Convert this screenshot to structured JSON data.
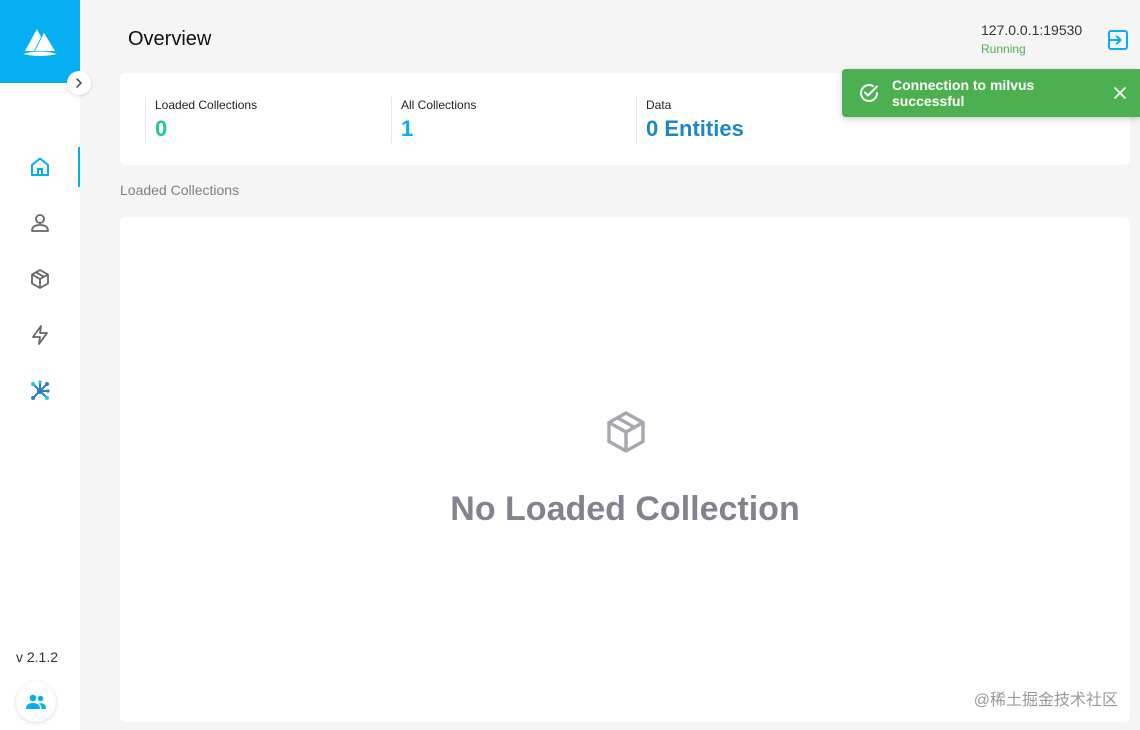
{
  "app": {
    "logo_icon": "milvus-logo-icon",
    "brand_color": "#06aff2"
  },
  "sidebar": {
    "items": [
      {
        "name": "home",
        "icon": "home-icon",
        "active": true
      },
      {
        "name": "users",
        "icon": "user-icon",
        "active": false
      },
      {
        "name": "collections",
        "icon": "cube-icon",
        "active": false
      },
      {
        "name": "search",
        "icon": "lightning-icon",
        "active": false
      },
      {
        "name": "system",
        "icon": "network-icon",
        "active": false
      }
    ],
    "version": "v 2.1.2"
  },
  "header": {
    "title": "Overview",
    "address": "127.0.0.1:19530",
    "status": "Running",
    "status_color": "#4caf50"
  },
  "stats": [
    {
      "label": "Loaded Collections",
      "value": "0",
      "color": "#1ec8a0"
    },
    {
      "label": "All Collections",
      "value": "1",
      "color": "#06aff2"
    },
    {
      "label": "Data",
      "value": "0 Entities",
      "color": "#1e85c9"
    }
  ],
  "main": {
    "section_label": "Loaded Collections",
    "empty_text": "No Loaded Collection",
    "watermark": "@稀土掘金技术社区"
  },
  "toast": {
    "message": "Connection to milvus successful",
    "color": "#4caf50"
  }
}
